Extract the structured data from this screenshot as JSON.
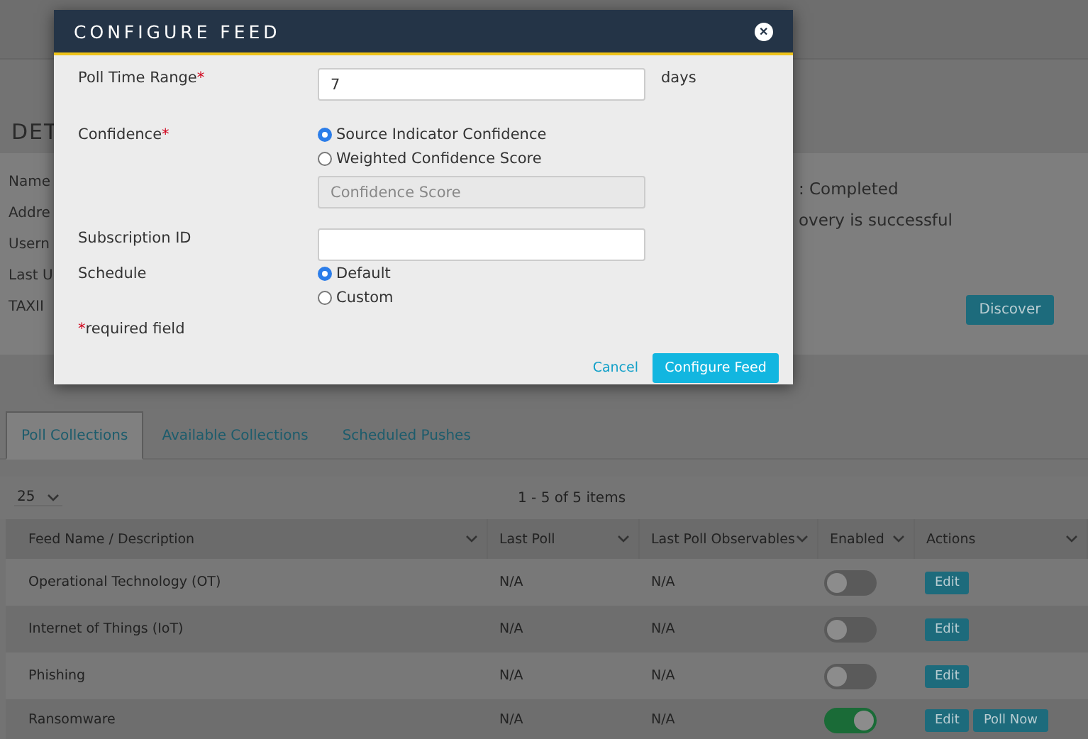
{
  "details": {
    "heading": "DET",
    "labels": [
      "Name",
      "Addre",
      "Usern",
      "Last U",
      "TAXII"
    ],
    "status_lines": [
      ": Completed",
      "overy is successful"
    ],
    "discover_button": "Discover"
  },
  "modal": {
    "title": "CONFIGURE FEED",
    "close": "✕",
    "poll_time_range": {
      "label": "Poll Time Range",
      "required_mark": "*",
      "value": "7",
      "unit": "days"
    },
    "confidence": {
      "label": "Confidence",
      "required_mark": "*",
      "options": [
        {
          "label": "Source Indicator Confidence",
          "selected": true
        },
        {
          "label": "Weighted Confidence Score",
          "selected": false
        }
      ],
      "score_placeholder": "Confidence Score",
      "score_disabled": true
    },
    "subscription_id": {
      "label": "Subscription ID"
    },
    "schedule": {
      "label": "Schedule",
      "options": [
        {
          "label": "Default",
          "selected": true
        },
        {
          "label": "Custom",
          "selected": false
        }
      ]
    },
    "required_note": {
      "mark": "*",
      "text": "required field"
    },
    "buttons": {
      "cancel": "Cancel",
      "confirm": "Configure Feed"
    }
  },
  "tabs": [
    {
      "label": "Poll Collections",
      "selected": true
    },
    {
      "label": "Available Collections",
      "selected": false
    },
    {
      "label": "Scheduled Pushes",
      "selected": false
    }
  ],
  "page_size": "25",
  "pagination": "1 - 5 of 5 items",
  "table": {
    "columns": [
      "Feed Name / Description",
      "Last Poll",
      "Last Poll Observables",
      "Enabled",
      "Actions"
    ],
    "rows": [
      {
        "name": "Operational Technology (OT)",
        "last_poll": "N/A",
        "observables": "N/A",
        "enabled": false,
        "actions": [
          "Edit"
        ]
      },
      {
        "name": "Internet of Things (IoT)",
        "last_poll": "N/A",
        "observables": "N/A",
        "enabled": false,
        "actions": [
          "Edit"
        ]
      },
      {
        "name": "Phishing",
        "last_poll": "N/A",
        "observables": "N/A",
        "enabled": false,
        "actions": [
          "Edit"
        ]
      },
      {
        "name": "Ransomware",
        "last_poll": "N/A",
        "observables": "N/A",
        "enabled": true,
        "actions": [
          "Edit",
          "Poll Now"
        ]
      }
    ]
  }
}
